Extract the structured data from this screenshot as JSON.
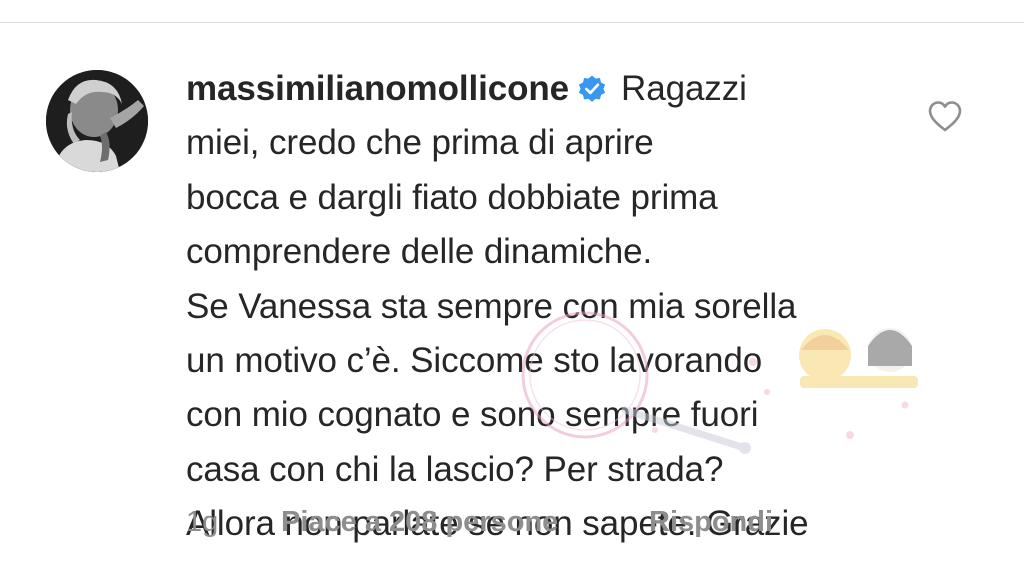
{
  "comment": {
    "username": "massimilianomollicone",
    "verified": true,
    "lines": [
      "Ragazzi",
      "miei, credo che prima di aprire",
      "bocca e dargli fiato dobbiate prima",
      "comprendere delle dinamiche.",
      "Se Vanessa sta sempre con mia sorella",
      "un motivo c’è. Siccome sto lavorando",
      "con mio cognato e sono sempre fuori",
      "casa con chi la lascio? Per strada?",
      "Allora non parlate se non sapete. Grazie"
    ]
  },
  "meta": {
    "time": "1g",
    "likes": "Piace a 208 persone",
    "reply": "Rispondi"
  },
  "icons": {
    "avatar": "avatar-photo",
    "verified": "verified-badge-icon",
    "like": "heart-icon"
  },
  "colors": {
    "text": "#262626",
    "muted": "#8e8e8e",
    "verified": "#3897f0",
    "divider": "#dbdbdb"
  }
}
